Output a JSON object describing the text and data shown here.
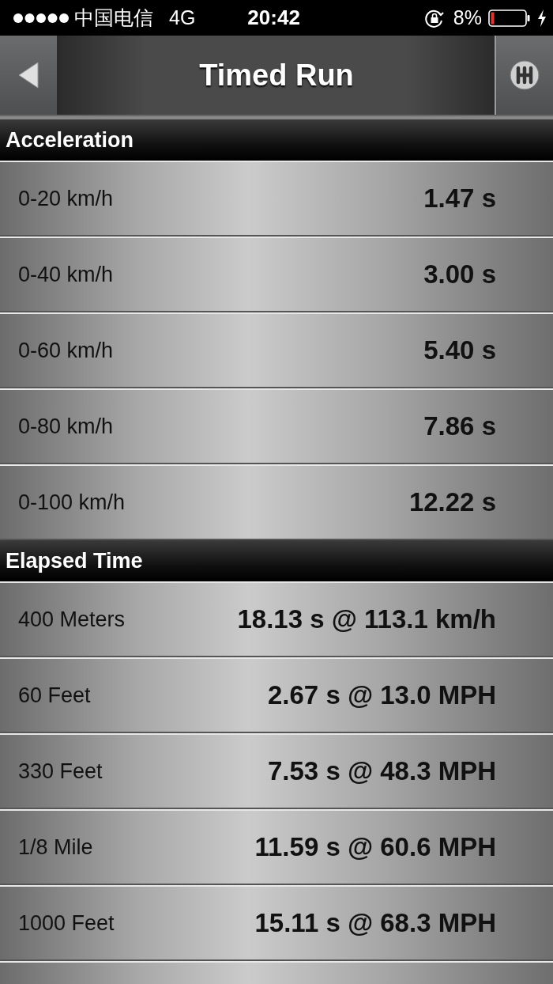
{
  "status_bar": {
    "carrier": "中国电信",
    "network": "4G",
    "time": "20:42",
    "battery": "8%"
  },
  "nav": {
    "title": "Timed Run"
  },
  "sections": [
    {
      "title": "Acceleration",
      "rows": [
        {
          "label": "0-20 km/h",
          "value": "1.47 s"
        },
        {
          "label": "0-40 km/h",
          "value": "3.00 s"
        },
        {
          "label": "0-60 km/h",
          "value": "5.40 s"
        },
        {
          "label": "0-80 km/h",
          "value": "7.86 s"
        },
        {
          "label": "0-100 km/h",
          "value": "12.22 s"
        }
      ]
    },
    {
      "title": "Elapsed Time",
      "rows": [
        {
          "label": "400 Meters",
          "value": "18.13 s @ 113.1 km/h"
        },
        {
          "label": "60 Feet",
          "value": "2.67 s @ 13.0 MPH"
        },
        {
          "label": "330 Feet",
          "value": "7.53 s @ 48.3 MPH"
        },
        {
          "label": "1/8 Mile",
          "value": "11.59 s @ 60.6 MPH"
        },
        {
          "label": "1000 Feet",
          "value": "15.11 s @ 68.3 MPH"
        }
      ]
    }
  ]
}
